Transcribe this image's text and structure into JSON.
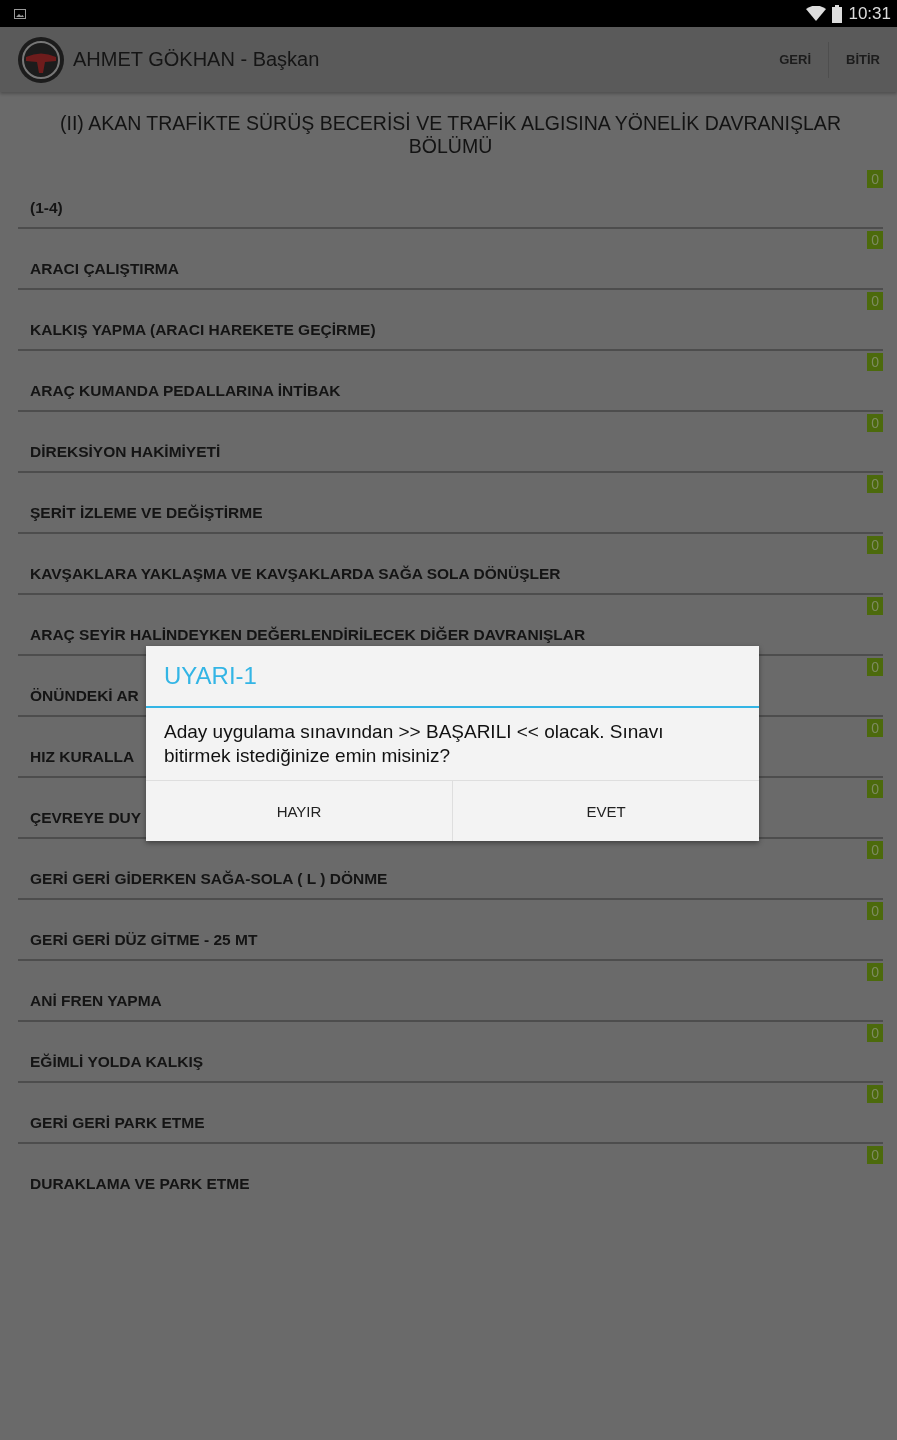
{
  "status_bar": {
    "time": "10:31"
  },
  "action_bar": {
    "title": "AHMET GÖKHAN - Başkan",
    "actions": [
      "GERİ",
      "BİTİR"
    ]
  },
  "section_title": "(II) AKAN TRAFİKTE SÜRÜŞ BECERİSİ VE TRAFİK ALGISINA YÖNELİK DAVRANIŞLAR BÖLÜMÜ",
  "rows": [
    {
      "label": "(1-4)",
      "badge": "0"
    },
    {
      "label": "ARACI ÇALIŞTIRMA",
      "badge": "0"
    },
    {
      "label": "KALKIŞ YAPMA (ARACI HAREKETE GEÇİRME)",
      "badge": "0"
    },
    {
      "label": "ARAÇ KUMANDA PEDALLARINA İNTİBAK",
      "badge": "0"
    },
    {
      "label": "DİREKSİYON HAKİMİYETİ",
      "badge": "0"
    },
    {
      "label": "ŞERİT İZLEME VE DEĞİŞTİRME",
      "badge": "0"
    },
    {
      "label": "KAVŞAKLARA YAKLAŞMA VE KAVŞAKLARDA SAĞA SOLA DÖNÜŞLER",
      "badge": "0"
    },
    {
      "label": "ARAÇ SEYİR HALİNDEYKEN DEĞERLENDİRİLECEK DİĞER DAVRANIŞLAR",
      "badge": "0"
    },
    {
      "label": "ÖNÜNDEKİ AR",
      "badge": "0"
    },
    {
      "label": "HIZ KURALLA",
      "badge": "0"
    },
    {
      "label": "ÇEVREYE DUY",
      "badge": "0"
    },
    {
      "label": "GERİ GERİ GİDERKEN SAĞA-SOLA ( L ) DÖNME",
      "badge": "0"
    },
    {
      "label": "GERİ GERİ DÜZ GİTME - 25 MT",
      "badge": "0"
    },
    {
      "label": "ANİ FREN YAPMA",
      "badge": "0"
    },
    {
      "label": "EĞİMLİ YOLDA KALKIŞ",
      "badge": "0"
    },
    {
      "label": "GERİ GERİ PARK ETME",
      "badge": "0"
    },
    {
      "label": "DURAKLAMA VE PARK ETME",
      "badge": "0"
    }
  ],
  "dialog": {
    "title": "UYARI-1",
    "message": "Aday uygulama sınavından >> BAŞARILI << olacak. Sınavı bitirmek istediğinize emin misiniz?",
    "buttons": [
      "HAYIR",
      "EVET"
    ]
  }
}
